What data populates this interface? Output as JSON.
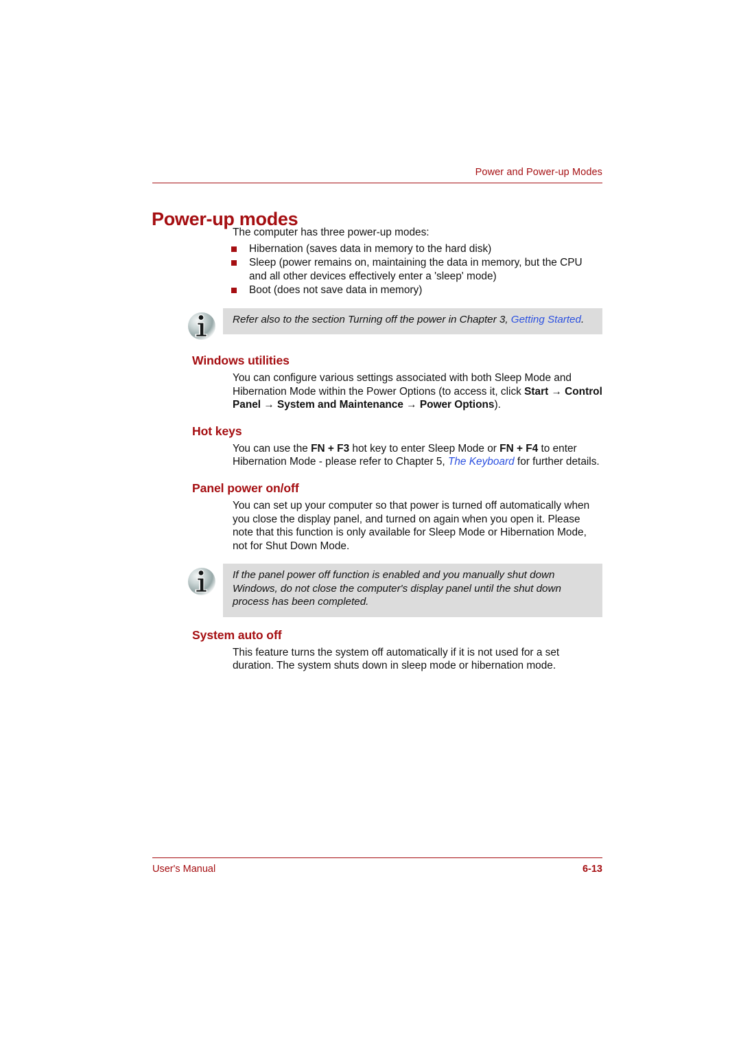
{
  "header": {
    "running_head": "Power and Power-up Modes"
  },
  "title": "Power-up modes",
  "intro": "The computer has three power-up modes:",
  "bullets": [
    "Hibernation (saves data in memory to the hard disk)",
    "Sleep (power remains on, maintaining the data in memory, but the CPU and all other devices effectively enter a 'sleep' mode)",
    "Boot (does not save data in memory)"
  ],
  "note1": {
    "icon": "info-icon",
    "text_part1": "Refer also to the section Turning off the power in Chapter 3, ",
    "link": "Getting Started",
    "text_part2": "."
  },
  "sections": [
    {
      "heading": "Windows utilities",
      "para_part1": "You can configure various settings associated with both Sleep Mode and Hibernation Mode within the Power Options (to access it, click ",
      "bold1": "Start → Control Panel → System and Maintenance → Power Options",
      "para_part2": ")."
    },
    {
      "heading": "Hot keys",
      "para_part1": "You can use the ",
      "bold1": "FN + F3",
      "para_part2": " hot key to enter Sleep Mode or ",
      "bold2": "FN + F4",
      "para_part3": " to enter Hibernation Mode - please refer to Chapter 5, ",
      "link": "The Keyboard",
      "para_part4": " for further details."
    },
    {
      "heading": "Panel power on/off",
      "para": "You can set up your computer so that power is turned off automatically when you close the display panel, and turned on again when you open it. Please note that this function is only available for Sleep Mode or Hibernation Mode, not for Shut Down Mode."
    },
    {
      "heading": "System auto off",
      "para": "This feature turns the system off automatically if it is not used for a set duration. The system shuts down in sleep mode or hibernation mode."
    }
  ],
  "note2": {
    "icon": "info-icon",
    "text": "If the panel power off function is enabled and you manually shut down Windows, do not close the computer's display panel until the shut down process has been completed."
  },
  "footer": {
    "left": "User's Manual",
    "right": "6-13"
  },
  "colors": {
    "accent_red": "#A50E11",
    "link_blue": "#2B50E0",
    "note_bg": "#DCDCDC"
  }
}
